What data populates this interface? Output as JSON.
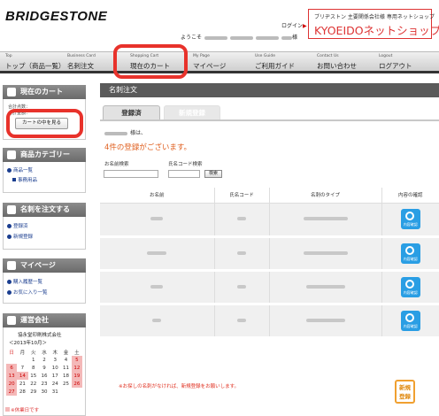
{
  "header": {
    "logo": "BRIDGESTONE",
    "login": "ログイン",
    "welcome": "ようこそ",
    "welcome_suffix": "様",
    "site_sub": "ブリヂストン 主要関係会社様 専用ネットショップ",
    "site_name": "KYOEIDOネットショップ"
  },
  "nav": [
    {
      "en": "Top",
      "jp": "トップ（商品一覧）"
    },
    {
      "en": "Business Card",
      "jp": "名刺注文"
    },
    {
      "en": "Shopping Cart",
      "jp": "現在のカート"
    },
    {
      "en": "My Page",
      "jp": "マイページ"
    },
    {
      "en": "Use Guide",
      "jp": "ご利用ガイド"
    },
    {
      "en": "Contact Us",
      "jp": "お問い合わせ"
    },
    {
      "en": "Logout",
      "jp": "ログアウト"
    }
  ],
  "sidebar": {
    "cart": {
      "title": "現在のカート",
      "line1": "合計点数：",
      "line2": "合計金額：",
      "button": "カートの中を見る"
    },
    "category": {
      "title": "商品カテゴリー",
      "items": [
        "商品一覧",
        "事務用品"
      ]
    },
    "card_order": {
      "title": "名刺を注文する",
      "items": [
        "登録済",
        "新規登録"
      ]
    },
    "mypage": {
      "title": "マイページ",
      "items": [
        "購入履歴一覧",
        "お気に入り一覧"
      ]
    },
    "company": {
      "title": "運営会社",
      "name": "協永堂印刷株式会社",
      "month": "＜2013年10月＞",
      "weekdays": [
        "日",
        "月",
        "火",
        "水",
        "木",
        "金",
        "土"
      ],
      "weeks": [
        [
          "",
          "",
          "1",
          "2",
          "3",
          "4",
          "5"
        ],
        [
          "6",
          "7",
          "8",
          "9",
          "10",
          "11",
          "12"
        ],
        [
          "13",
          "14",
          "15",
          "16",
          "17",
          "18",
          "19"
        ],
        [
          "20",
          "21",
          "22",
          "23",
          "24",
          "25",
          "26"
        ],
        [
          "27",
          "28",
          "29",
          "30",
          "31",
          "",
          ""
        ]
      ],
      "note": "※休業日です"
    }
  },
  "main": {
    "title": "名刺注文",
    "tabs": [
      "登録済",
      "新規登録"
    ],
    "user_suffix": "様は、",
    "count_text": "4件の登録がございます。",
    "search": {
      "name_label": "お名前検索",
      "code_label": "氏名コード検索",
      "button": "検索"
    },
    "table": {
      "headers": [
        "お名前",
        "氏名コード",
        "名刺のタイプ",
        "内容の確認"
      ],
      "icon_text": "内容確認"
    },
    "notice": "※お探しの名刺がなければ、新規登録をお願いします。",
    "new_button": [
      "新規",
      "登録"
    ]
  }
}
